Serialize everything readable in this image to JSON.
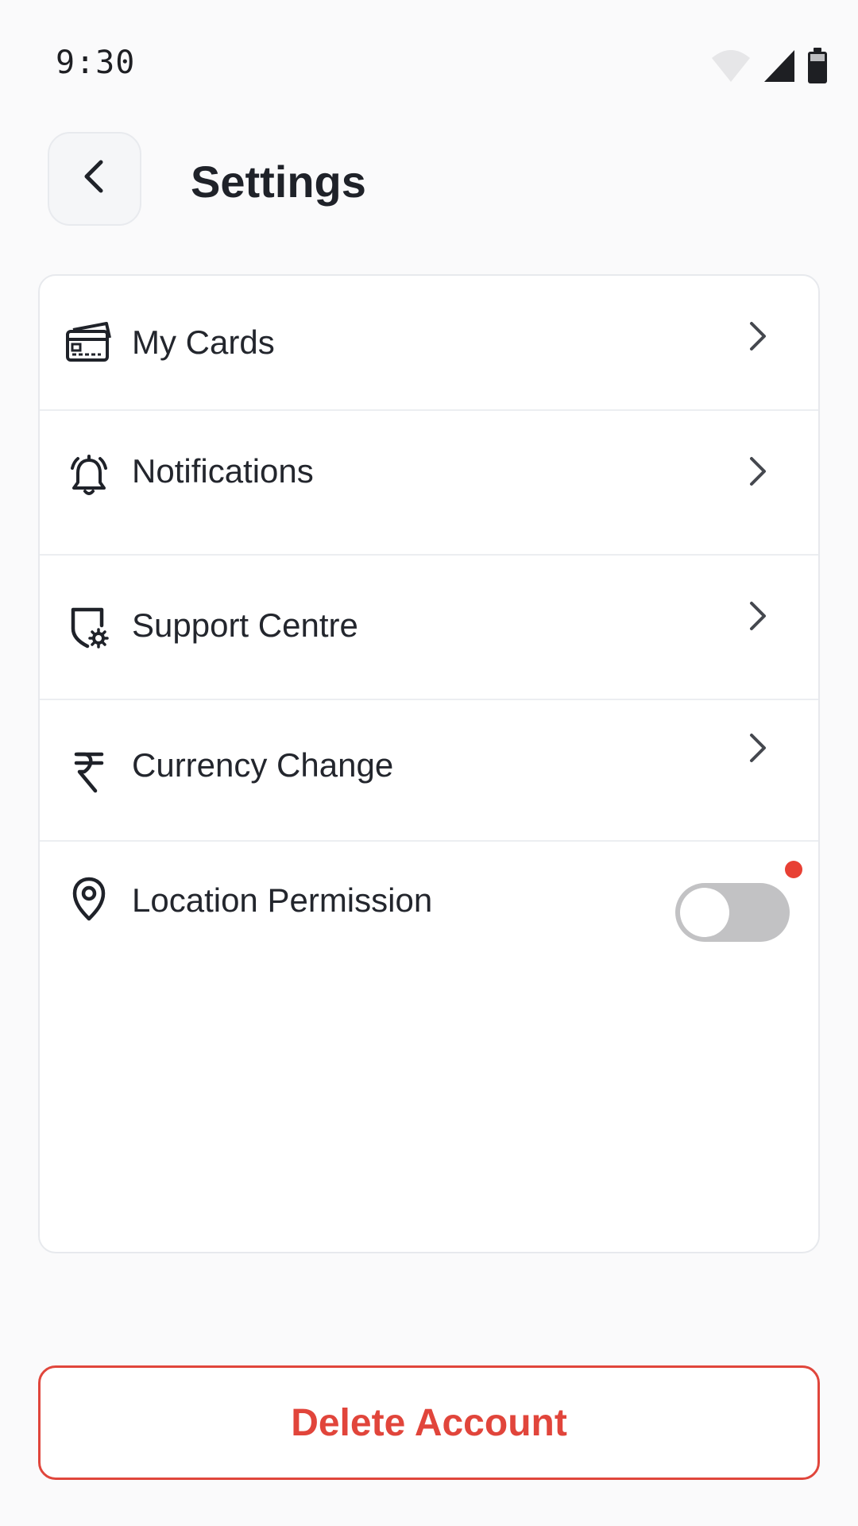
{
  "status_bar": {
    "time": "9:30",
    "icons": [
      "wifi-icon",
      "cellular-signal-icon",
      "battery-icon"
    ]
  },
  "header": {
    "back_icon": "chevron-left-icon",
    "title": "Settings"
  },
  "settings": {
    "items": [
      {
        "label": "My Cards",
        "icon": "credit-card-icon",
        "action": "chevron-right-icon"
      },
      {
        "label": "Notifications",
        "icon": "bell-icon",
        "action": "chevron-right-icon"
      },
      {
        "label": "Support Centre",
        "icon": "shield-gear-icon",
        "action": "chevron-right-icon"
      },
      {
        "label": "Currency Change",
        "icon": "rupee-icon",
        "action": "chevron-right-icon"
      },
      {
        "label": "Location Permission",
        "icon": "location-pin-icon",
        "action": "toggle",
        "toggle_on": false,
        "has_alert_dot": true
      }
    ]
  },
  "footer": {
    "delete_label": "Delete Account"
  },
  "colors": {
    "background": "#fafafb",
    "card": "#ffffff",
    "danger": "#e1453b",
    "toggle_off": "#c2c2c4",
    "text": "#23262d"
  }
}
